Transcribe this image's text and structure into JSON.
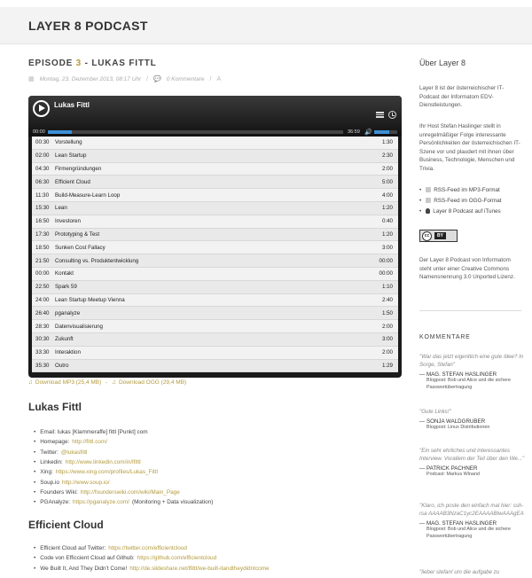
{
  "site": {
    "title": "LAYER 8 PODCAST"
  },
  "post": {
    "title_prefix": "EPISODE",
    "title_num": "3",
    "title_suffix": "- LUKAS FITTL",
    "date": "Montag, 23. Dezember 2013, 08:17 Uhr",
    "comments": "0 Kommentare",
    "font_icon": "A"
  },
  "player": {
    "title": "Lukas Fittl",
    "time_current": "00:00",
    "time_total": "36:59",
    "progress_fraction": 0.08,
    "volume_fraction": 0.65,
    "chapters": [
      {
        "start": "00:30",
        "title": "Vorstellung",
        "duration": "1:30"
      },
      {
        "start": "02:00",
        "title": "Lean Startup",
        "duration": "2:30"
      },
      {
        "start": "04:30",
        "title": "Firmengründungen",
        "duration": "2:00"
      },
      {
        "start": "06:30",
        "title": "Efficient Cloud",
        "duration": "5:00"
      },
      {
        "start": "11:30",
        "title": "Build-Measure-Learn Loop",
        "duration": "4:00"
      },
      {
        "start": "15:30",
        "title": "Lean",
        "duration": "1:20"
      },
      {
        "start": "16:50",
        "title": "Investoren",
        "duration": "0:40"
      },
      {
        "start": "17:30",
        "title": "Prototyping & Test",
        "duration": "1:20"
      },
      {
        "start": "18:50",
        "title": "Sunken Cost Fallacy",
        "duration": "3:00"
      },
      {
        "start": "21:50",
        "title": "Consulting vs. Produktentwicklung",
        "duration": "00:00"
      },
      {
        "start": "00:00",
        "title": "Kontakt",
        "duration": "00:00"
      },
      {
        "start": "22:50",
        "title": "Spark 59",
        "duration": "1:10"
      },
      {
        "start": "24:00",
        "title": "Lean Startup Meetup Vienna",
        "duration": "2:40"
      },
      {
        "start": "26:40",
        "title": "pganalyze",
        "duration": "1:50"
      },
      {
        "start": "28:30",
        "title": "Datenvisualisierung",
        "duration": "2:00"
      },
      {
        "start": "30:30",
        "title": "Zukunft",
        "duration": "3:00"
      },
      {
        "start": "33:30",
        "title": "Interaktion",
        "duration": "2:00"
      },
      {
        "start": "35:30",
        "title": "Outro",
        "duration": "1:29"
      }
    ]
  },
  "downloads": {
    "mp3": "Download MP3 (25,4 MB)",
    "sep": "-",
    "ogg": "Download OGG (29,4 MB)"
  },
  "section1": {
    "heading": "Lukas Fittl",
    "items": [
      {
        "label": "Email: lukas [Klammeraffe] fittl [Punkt] com",
        "link": ""
      },
      {
        "label": "Homepage:",
        "link": "http://fittl.com/"
      },
      {
        "label": "Twitter:",
        "link": "@lukasfittl"
      },
      {
        "label": "Linkedin:",
        "link": "http://www.linkedin.com/in/lfittl"
      },
      {
        "label": "Xing:",
        "link": "https://www.xing.com/profiles/Lukas_Fittl"
      },
      {
        "label": "Soup.io",
        "link": "http://www.soup.io/"
      },
      {
        "label": "Founders Wiki:",
        "link": "http://founderswiki.com/wiki/Main_Page"
      },
      {
        "label": "PGAnalyze:",
        "link": "https://pganalyze.com/",
        "suffix": "(Monitoring + Data visualization)"
      }
    ]
  },
  "section2": {
    "heading": "Efficient Cloud",
    "items": [
      {
        "label": "Efficient Cloud auf Twitter:",
        "link": "https://twitter.com/efficientcloud"
      },
      {
        "label": "Code von Efficcient Cloud auf Github:",
        "link": "https://github.com/efficientcloud"
      },
      {
        "label": "We Built It, And They Didn't Come!",
        "link": "http://de.slideshare.net/lfittl/we-built-itandtheydidntcome"
      }
    ]
  },
  "sidebar": {
    "about_title": "Über Layer 8",
    "about_p1": "Layer 8 ist der österreichischer IT-Podcast der Informatom EDV-Dienstleistungen.",
    "about_p2": "Ihr Host Stefan Haslinger stellt in unregelmäßiger Folge interessante Persönlichkeiten der österreichischen IT-Szene vor und plaudert mit ihnen über Business, Technologie, Menschen und Trivia.",
    "links": [
      {
        "icon": "rss-icon",
        "label": "RSS-Feed im MP3-Format"
      },
      {
        "icon": "rss-icon",
        "label": "RSS-Feed im OGG-Format"
      },
      {
        "icon": "apple-icon",
        "label": "Layer 8 Podcast auf iTunes"
      }
    ],
    "cc_label": "cc",
    "cc_by": "BY",
    "license_text": "Der Layer 8 Podcast von Informatom steht unter einer Creative Commons Namensnennung 3.0 Unported Lizenz.",
    "comments_title": "KOMMENTARE",
    "comments": [
      {
        "quote": "\"War das jetzt eigentlich eine gute Idee? In Sorge, Stefan\"",
        "author": "MAG. STEFAN HASLINGER",
        "post": "Blogpost: Bob und Alice und die sichere Passwortübertragung"
      },
      {
        "quote": "\"Gute Links!\"",
        "author": "SONJA WALDGRUBER",
        "post": "Blogpost: Linux Distributionen"
      },
      {
        "quote": "\"Ein sehr ehrliches und interessantes Interview. Vorallem der Teil über den We...\"",
        "author": "PATRICK PACHNER",
        "post": "Podcast: Markus Winand"
      },
      {
        "quote": "\"Klaro, ich poste den einfach mal hier: ssh-rsa AAAAB3NzaC1yc2EAAAABIwAAAgEA",
        "author": "MAG. STEFAN HASLINGER",
        "post": "Blogpost: Bob und Alice und die sichere Passwortübertragung"
      },
      {
        "quote": "\"lieber stefan! um die aufgabe zu",
        "author": "",
        "post": ""
      }
    ]
  }
}
